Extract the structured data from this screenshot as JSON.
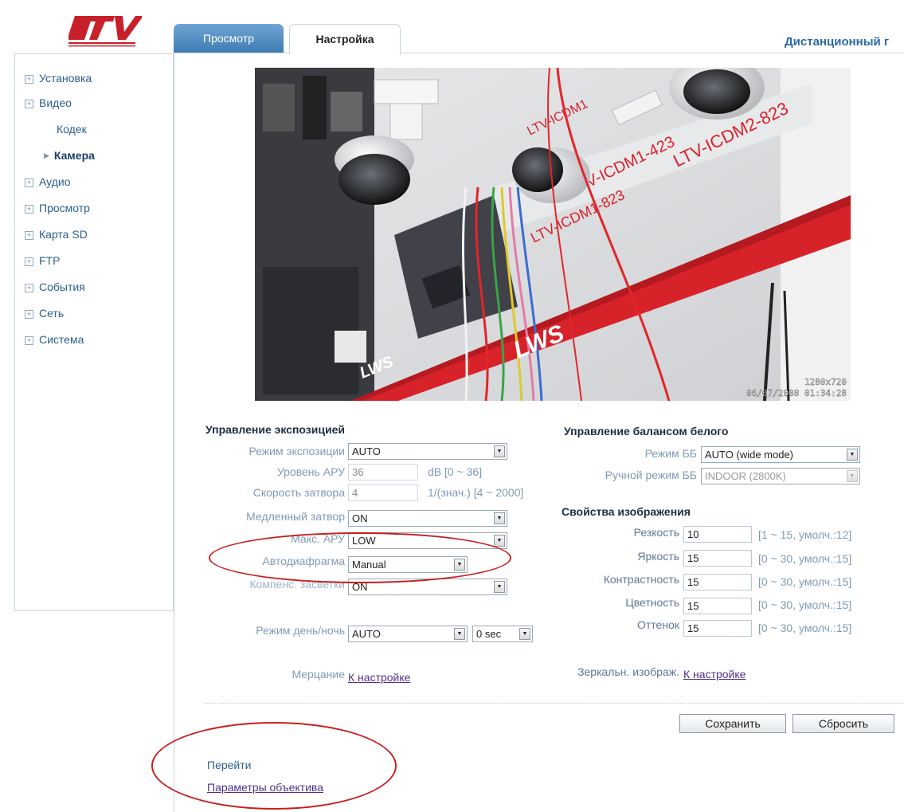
{
  "header": {
    "logo_text": "LTV",
    "tabs": [
      {
        "label": "Просмотр"
      },
      {
        "label": "Настройка"
      }
    ],
    "remote_title": "Дистанционный г"
  },
  "sidebar": {
    "items": [
      {
        "label": "Установка"
      },
      {
        "label": "Видео"
      },
      {
        "label": "Кодек"
      },
      {
        "label": "Камера"
      },
      {
        "label": "Аудио"
      },
      {
        "label": "Просмотр"
      },
      {
        "label": "Карта SD"
      },
      {
        "label": "FTP"
      },
      {
        "label": "События"
      },
      {
        "label": "Сеть"
      },
      {
        "label": "Система"
      }
    ]
  },
  "camera_image": {
    "labels": [
      "LTV-ICDM2-823",
      "LTV-ICDM1-423",
      "LTV-ICDM1-823",
      "LTV-ICDM1",
      "LWS"
    ],
    "resolution": "1280x720",
    "timestamp": "06/07/2008 01:34:28"
  },
  "exposure": {
    "title": "Управление экспозицией",
    "mode_label": "Режим экспозиции",
    "mode_value": "AUTO",
    "agc_label": "Уровень АРУ",
    "agc_value": "36",
    "agc_hint": "dB [0 ~ 36]",
    "shutter_label": "Скорость затвора",
    "shutter_value": "4",
    "shutter_hint": "1/(знач.) [4 ~ 2000]",
    "slow_shutter_label": "Медленный затвор",
    "slow_shutter_value": "ON",
    "max_agc_label": "Макс. АРУ",
    "max_agc_value": "LOW",
    "iris_label": "Автодиафрагма",
    "iris_value": "Manual",
    "blc_label": "Компенс. засветки",
    "blc_value": "ON",
    "daynight_label": "Режим день/ночь",
    "daynight_value": "AUTO",
    "daynight_delay": "0 sec",
    "flicker_label": "Мерцание",
    "flicker_link": "К настройке"
  },
  "white_balance": {
    "title": "Управление балансом белого",
    "mode_label": "Режим ББ",
    "mode_value": "AUTO (wide mode)",
    "manual_label": "Ручной режим ББ",
    "manual_value": "INDOOR (2800K)"
  },
  "image_props": {
    "title": "Свойства изображения",
    "rows": [
      {
        "label": "Резкость",
        "value": "10",
        "hint": "[1 ~ 15, умолч.:12]"
      },
      {
        "label": "Яркость",
        "value": "15",
        "hint": "[0 ~ 30, умолч.:15]"
      },
      {
        "label": "Контрастность",
        "value": "15",
        "hint": "[0 ~ 30, умолч.:15]"
      },
      {
        "label": "Цветность",
        "value": "15",
        "hint": "[0 ~ 30, умолч.:15]"
      },
      {
        "label": "Оттенок",
        "value": "15",
        "hint": "[0 ~ 30, умолч.:15]"
      }
    ],
    "mirror_label": "Зеркальн. изображ.",
    "mirror_link": "К настройке"
  },
  "actions": {
    "save": "Сохранить",
    "reset": "Сбросить"
  },
  "goto": {
    "label": "Перейти",
    "lens_link": "Параметры объектива"
  },
  "colors": {
    "accent": "#2b5e8e",
    "tab_active_bg": "#ffffff",
    "tab_bg": "#3f7db5",
    "annotation": "#c81e1e"
  }
}
